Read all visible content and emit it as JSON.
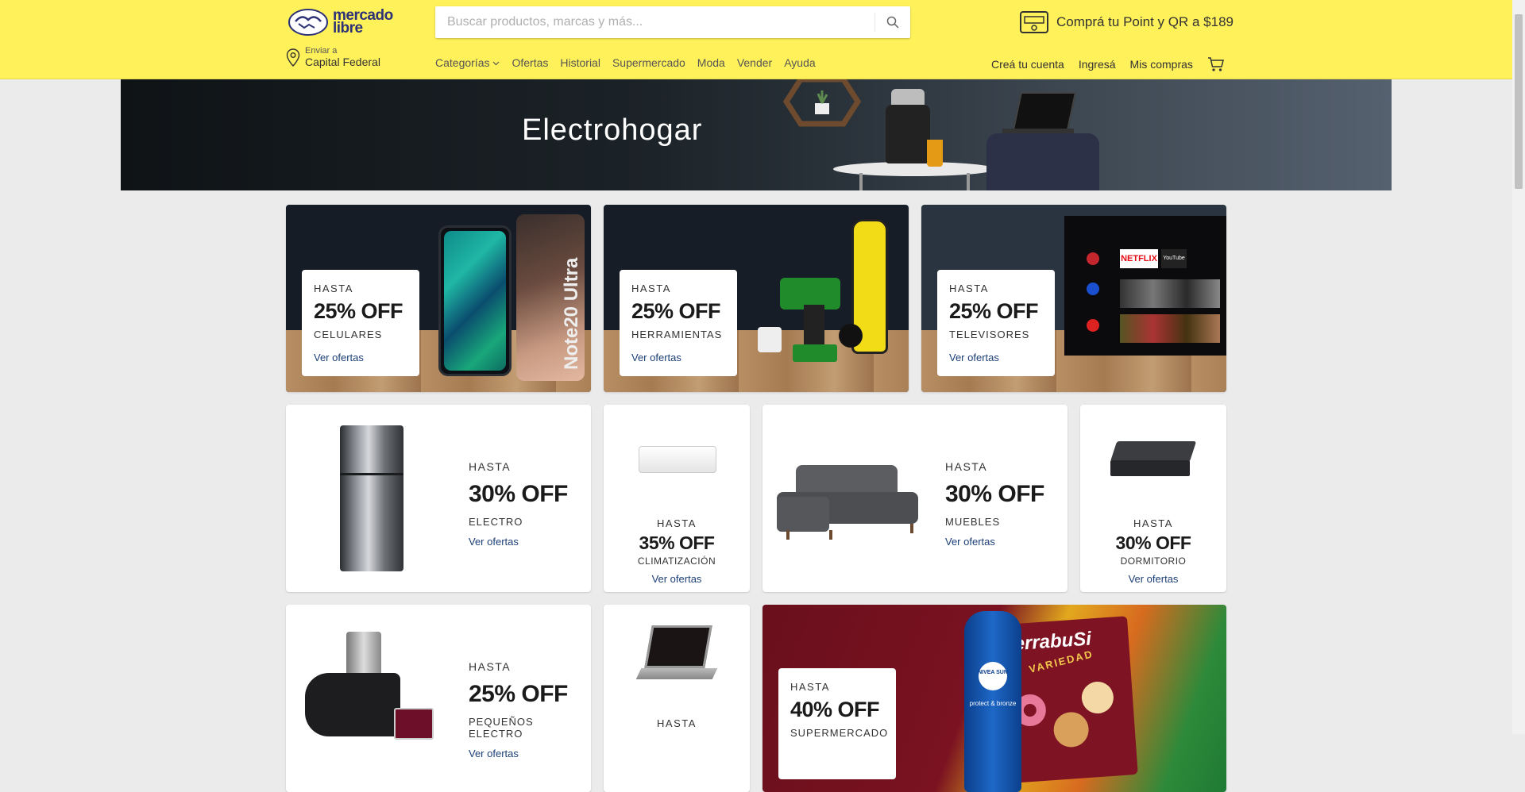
{
  "header": {
    "logo_text_line1": "mercado",
    "logo_text_line2": "libre",
    "search_placeholder": "Buscar productos, marcas y más...",
    "promo": "Comprá tu Point y QR a $189",
    "location_label": "Enviar a",
    "location_value": "Capital Federal",
    "nav": [
      "Categorías",
      "Ofertas",
      "Historial",
      "Supermercado",
      "Moda",
      "Vender",
      "Ayuda"
    ],
    "user_nav": [
      "Creá tu cuenta",
      "Ingresá",
      "Mis compras"
    ],
    "brand_color": "#fff159"
  },
  "hero": {
    "title": "Electrohogar"
  },
  "cards": {
    "celulares": {
      "hasta": "HASTA",
      "pct": "25% OFF",
      "cat": "CELULARES",
      "link": "Ver ofertas"
    },
    "herramientas": {
      "hasta": "HASTA",
      "pct": "25% OFF",
      "cat": "HERRAMIENTAS",
      "link": "Ver ofertas"
    },
    "televisores": {
      "hasta": "HASTA",
      "pct": "25% OFF",
      "cat": "TELEVISORES",
      "link": "Ver ofertas"
    },
    "electro": {
      "hasta": "HASTA",
      "pct": "30% OFF",
      "cat": "ELECTRO",
      "link": "Ver ofertas"
    },
    "climatizacion": {
      "hasta": "HASTA",
      "pct": "35% OFF",
      "cat": "CLIMATIZACIÓN",
      "link": "Ver ofertas"
    },
    "muebles": {
      "hasta": "HASTA",
      "pct": "30% OFF",
      "cat": "MUEBLES",
      "link": "Ver ofertas"
    },
    "dormitorio": {
      "hasta": "HASTA",
      "pct": "30% OFF",
      "cat": "DORMITORIO",
      "link": "Ver ofertas"
    },
    "pequenos": {
      "hasta": "HASTA",
      "pct": "25% OFF",
      "cat": "PEQUEÑOS ELECTRO",
      "link": "Ver ofertas"
    },
    "computacion": {
      "hasta": "HASTA"
    },
    "supermercado": {
      "hasta": "HASTA",
      "pct": "40% OFF",
      "cat": "SUPERMERCADO"
    }
  },
  "tv_apps": [
    "NETFLIX",
    "YouTube"
  ],
  "phone_text": "Note20 Ultra",
  "snack_brand": "TerrabuSi",
  "snack_sub": "VARIEDAD",
  "sunscreen_brand": "NIVEA SUN",
  "sunscreen_sub": "protect & bronze"
}
